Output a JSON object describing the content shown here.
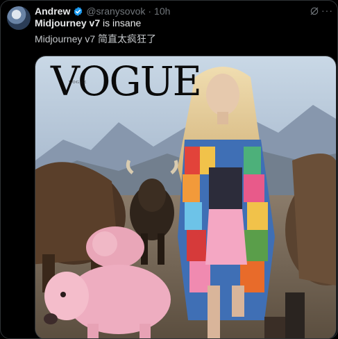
{
  "tweet": {
    "author_name": "Andrew",
    "handle": "@sranysovok",
    "separator": "·",
    "time": "10h",
    "text_bold": "Midjourney v7",
    "text_rest": " is insane",
    "quote_text": "Midjourney v7 简直太疯狂了",
    "more_label": "···"
  },
  "media": {
    "magazine_title": "VOGUE",
    "magazine_sub": "VOGUE"
  },
  "colors": {
    "background": "#000000",
    "text": "#e7e9ea",
    "secondary": "#71767b",
    "verified": "#1d9bf0"
  }
}
